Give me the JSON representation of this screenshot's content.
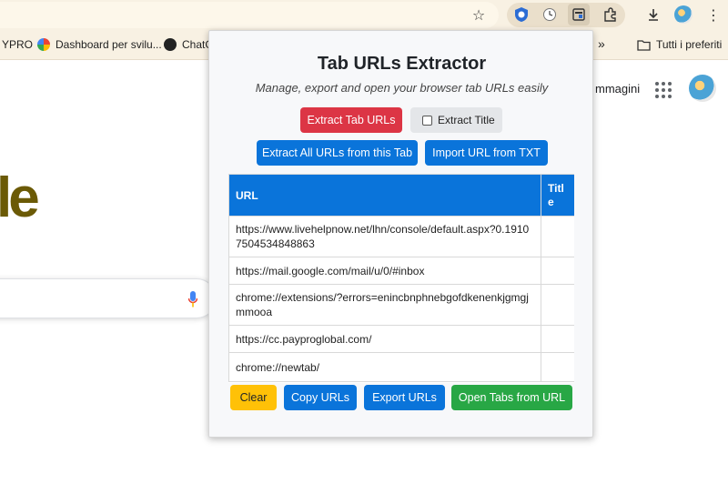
{
  "browser": {
    "bookmarks": [
      {
        "label": "YPRO"
      },
      {
        "label": "Dashboard per svilu..."
      },
      {
        "label": "ChatG"
      },
      {
        "label": "Tutti i preferiti"
      }
    ],
    "more_bookmarks": "»"
  },
  "background_page": {
    "logo_fragment": "le",
    "images_link": "mmagini"
  },
  "popup": {
    "title": "Tab URLs Extractor",
    "subtitle": "Manage, export and open your browser tab URLs easily",
    "extract_tab_urls_label": "Extract Tab URLs",
    "extract_title_label": "Extract Title",
    "extract_title_checked": false,
    "extract_all_label": "Extract All URLs from this Tab",
    "import_label": "Import URL from TXT",
    "table": {
      "headers": [
        "URL",
        "Title"
      ],
      "rows": [
        {
          "url": "https://www.livehelpnow.net/lhn/console/default.aspx?0.19107504534848863",
          "title": ""
        },
        {
          "url": "https://mail.google.com/mail/u/0/#inbox",
          "title": ""
        },
        {
          "url": "chrome://extensions/?errors=enincbnphnebgofdkenenkjgmgjmmooa",
          "title": ""
        },
        {
          "url": "https://cc.payproglobal.com/",
          "title": ""
        },
        {
          "url": "chrome://newtab/",
          "title": ""
        }
      ]
    },
    "clear_label": "Clear",
    "copy_label": "Copy URLs",
    "export_label": "Export URLs",
    "open_label": "Open Tabs from URL"
  },
  "colors": {
    "red": "#dc3545",
    "blue": "#0a74da",
    "yellow": "#ffc107",
    "green": "#28a745"
  }
}
